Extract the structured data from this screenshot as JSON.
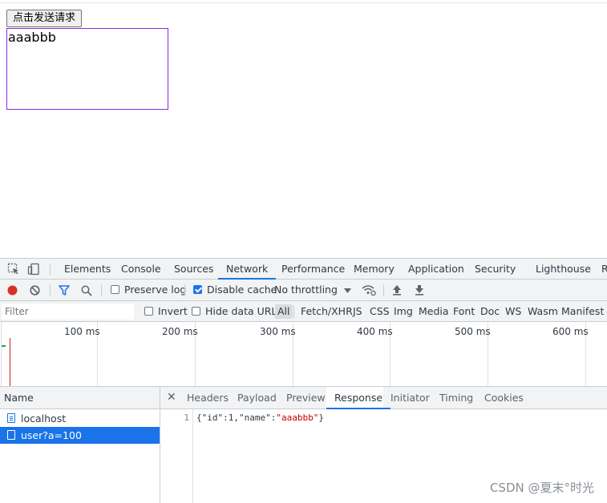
{
  "page": {
    "send_button_label": "点击发送请求",
    "result_text": "aaabbb"
  },
  "devtools": {
    "tabs": [
      "Elements",
      "Console",
      "Sources",
      "Network",
      "Performance",
      "Memory",
      "Application",
      "Security",
      "Lighthouse",
      "R"
    ],
    "active_tab": "Network",
    "toolbar": {
      "preserve_log": "Preserve log",
      "preserve_log_checked": false,
      "disable_cache": "Disable cache",
      "disable_cache_checked": true,
      "throttling": "No throttling"
    },
    "filterbar": {
      "filter_placeholder": "Filter",
      "invert": "Invert",
      "hide_data_urls": "Hide data URLs",
      "types": [
        "All",
        "Fetch/XHR",
        "JS",
        "CSS",
        "Img",
        "Media",
        "Font",
        "Doc",
        "WS",
        "Wasm",
        "Manifest"
      ],
      "active_type": "All"
    },
    "timeline": {
      "labels": [
        "100 ms",
        "200 ms",
        "300 ms",
        "400 ms",
        "500 ms",
        "600 ms"
      ]
    },
    "requests": {
      "header": "Name",
      "items": [
        {
          "name": "localhost",
          "selected": false
        },
        {
          "name": "user?a=100",
          "selected": true
        }
      ]
    },
    "detail": {
      "tabs": [
        "Headers",
        "Payload",
        "Preview",
        "Response",
        "Initiator",
        "Timing",
        "Cookies"
      ],
      "active_tab": "Response",
      "line_number": "1",
      "response": {
        "p1": "{",
        "k1": "\"id\"",
        "p2": ":1,",
        "k2": "\"name\"",
        "p3": ":",
        "v2": "\"aaabbb\"",
        "p4": "}"
      }
    }
  },
  "watermark": "CSDN @夏末°时光",
  "colors": {
    "accent": "#1a73e8",
    "record": "#d93025",
    "result_border": "#8a2be2"
  }
}
